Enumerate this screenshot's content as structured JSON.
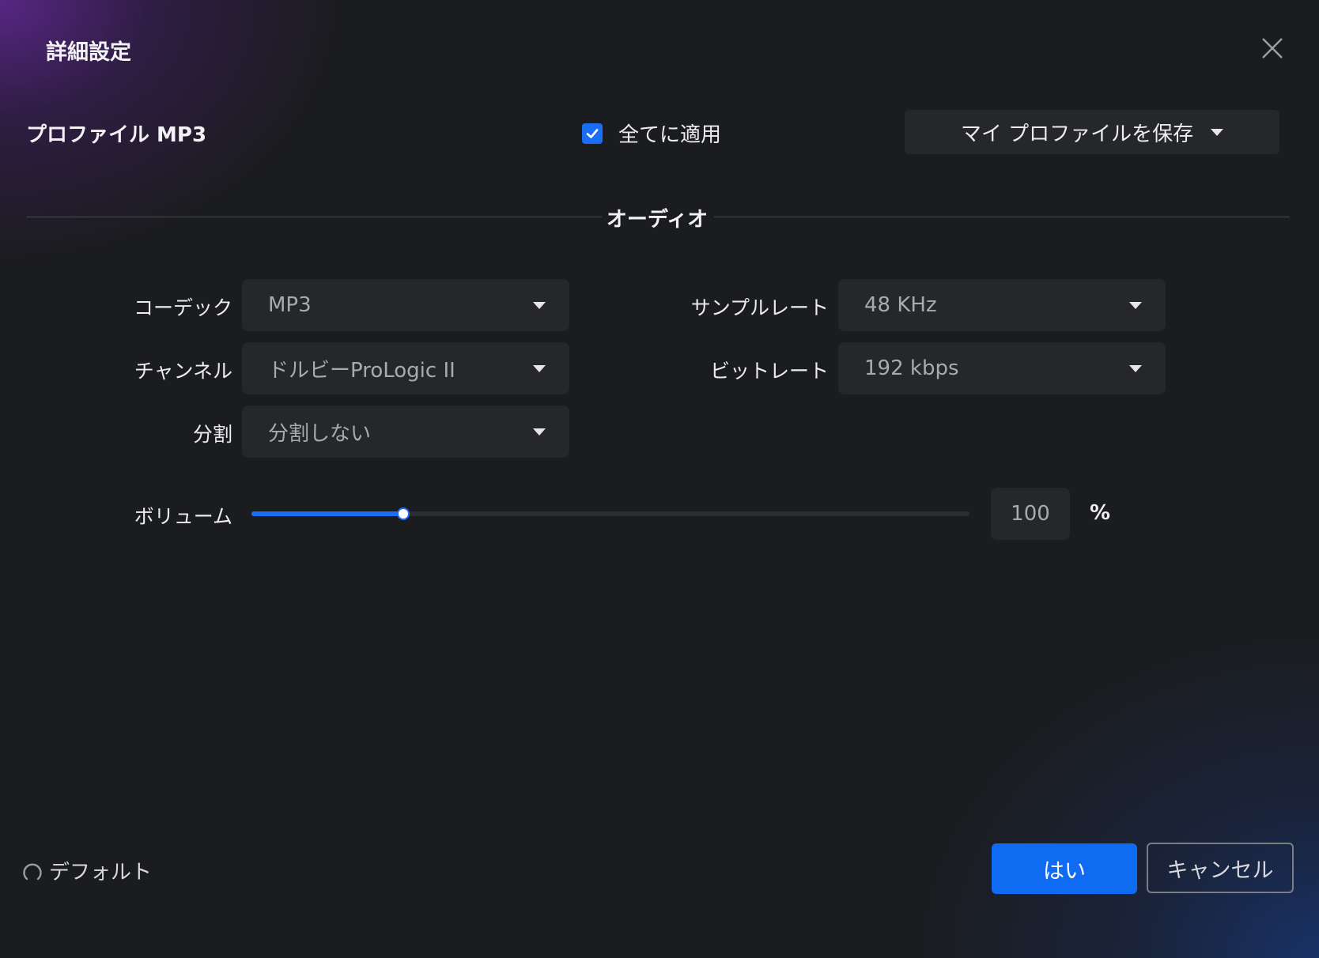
{
  "dialog": {
    "title": "詳細設定",
    "close_icon": "close-icon"
  },
  "profile": {
    "label": "プロファイル  MP3",
    "apply_all_label": "全てに適用",
    "apply_all_checked": true,
    "save_profile_label": "マイ プロファイルを保存"
  },
  "section": {
    "title": "オーディオ"
  },
  "audio": {
    "codec": {
      "label": "コーデック",
      "value": "MP3"
    },
    "sample_rate": {
      "label": "サンプルレート",
      "value": "48 KHz"
    },
    "channel": {
      "label": "チャンネル",
      "value": "ドルビーProLogic II"
    },
    "bitrate": {
      "label": "ビットレート",
      "value": "192 kbps"
    },
    "split": {
      "label": "分割",
      "value": "分割しない"
    },
    "volume": {
      "label": "ボリューム",
      "value": "100",
      "unit": "%",
      "slider_fraction": 0.21
    }
  },
  "footer": {
    "default_label": "デフォルト",
    "ok_label": "はい",
    "cancel_label": "キャンセル"
  },
  "colors": {
    "accent": "#1a6ef5",
    "background": "#1b1c1f",
    "control_bg": "#26272b"
  }
}
